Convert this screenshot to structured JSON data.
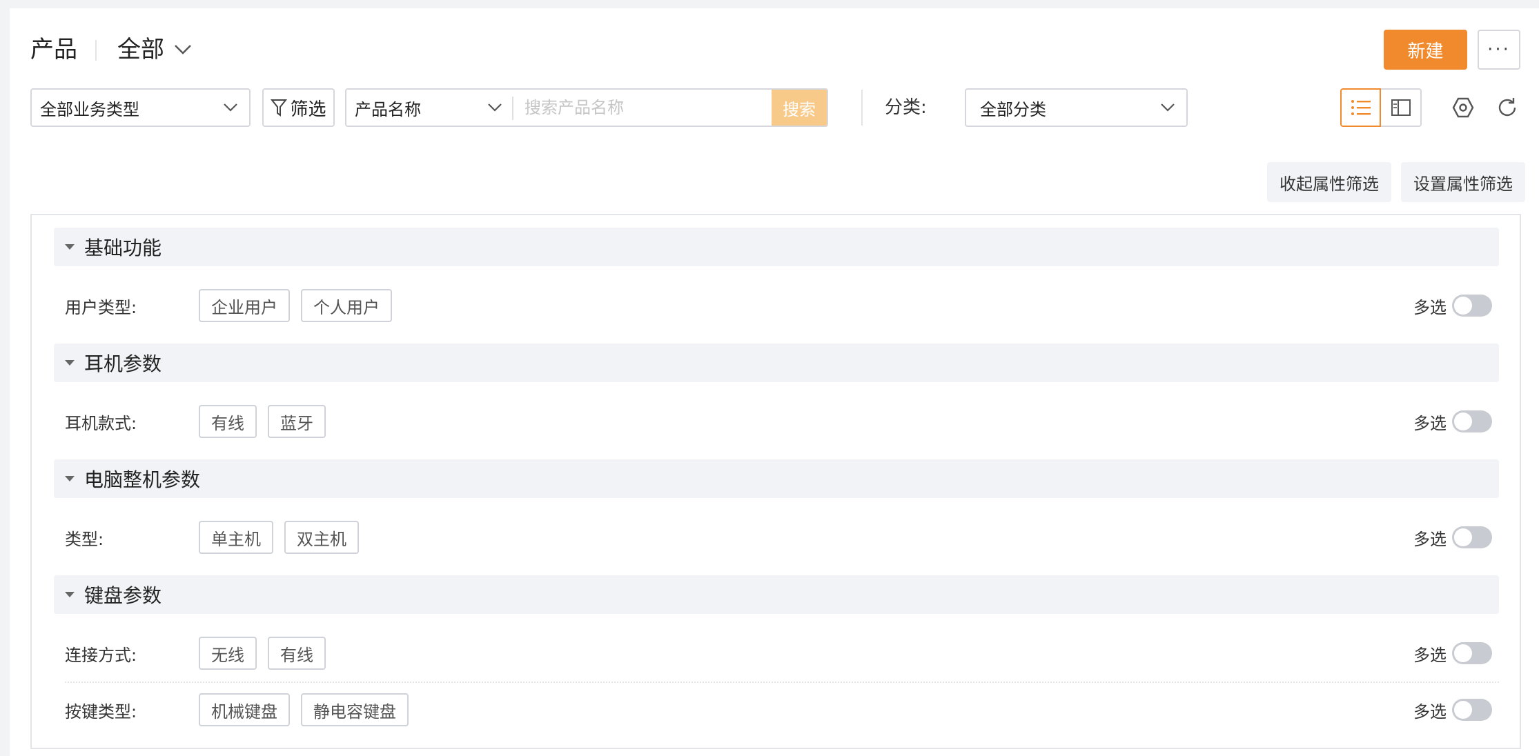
{
  "header": {
    "title": "产品",
    "scope_label": "全部",
    "new_button_label": "新建",
    "more_label": "···"
  },
  "toolbar": {
    "business_type_value": "全部业务类型",
    "filter_label": "筛选",
    "search_field_value": "产品名称",
    "search_placeholder": "搜索产品名称",
    "search_button_label": "搜索",
    "category_label": "分类:",
    "category_value": "全部分类"
  },
  "attr_actions": {
    "collapse_label": "收起属性筛选",
    "settings_label": "设置属性筛选"
  },
  "groups": [
    {
      "title": "基础功能",
      "rows": [
        {
          "label": "用户类型:",
          "tags": [
            "企业用户",
            "个人用户"
          ],
          "multi_label": "多选",
          "multi_enabled": false
        }
      ]
    },
    {
      "title": "耳机参数",
      "rows": [
        {
          "label": "耳机款式:",
          "tags": [
            "有线",
            "蓝牙"
          ],
          "multi_label": "多选",
          "multi_enabled": false
        }
      ]
    },
    {
      "title": "电脑整机参数",
      "rows": [
        {
          "label": "类型:",
          "tags": [
            "单主机",
            "双主机"
          ],
          "multi_label": "多选",
          "multi_enabled": false
        }
      ]
    },
    {
      "title": "键盘参数",
      "rows": [
        {
          "label": "连接方式:",
          "tags": [
            "无线",
            "有线"
          ],
          "multi_label": "多选",
          "multi_enabled": false
        },
        {
          "label": "按键类型:",
          "tags": [
            "机械键盘",
            "静电容键盘"
          ],
          "multi_label": "多选",
          "multi_enabled": false
        }
      ]
    }
  ],
  "colors": {
    "accent": "#f08a2c",
    "search_button": "#f8ca8a",
    "group_bg": "#f2f3f7"
  }
}
